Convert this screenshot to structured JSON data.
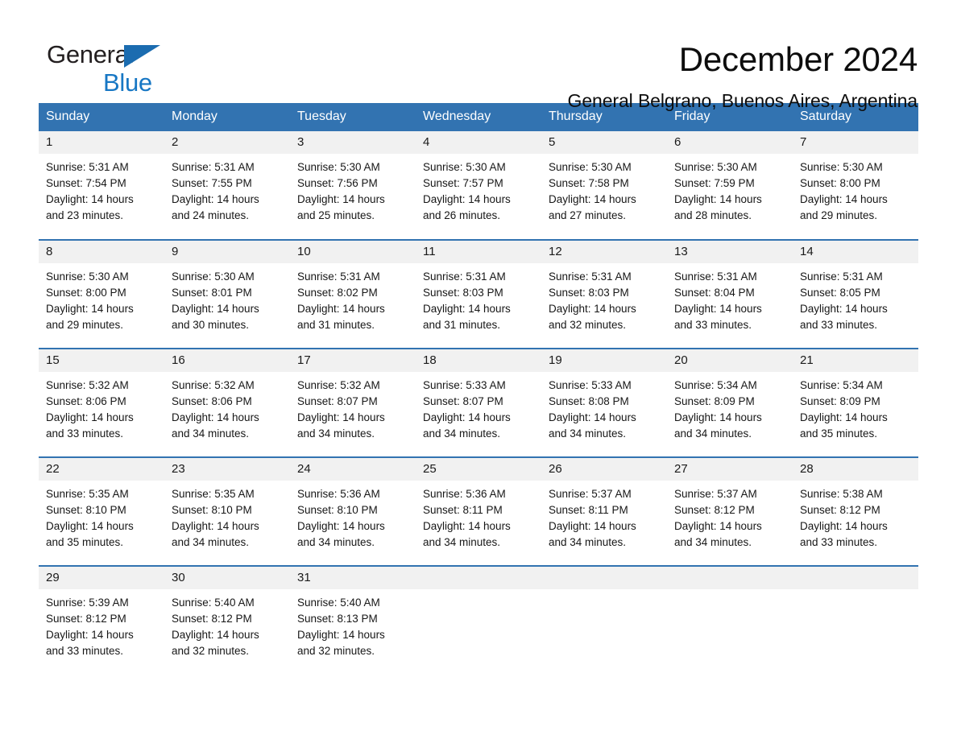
{
  "brand": {
    "line1": "General",
    "line2": "Blue",
    "accent_color": "#1777c4",
    "triangle_color": "#1b6cb0"
  },
  "header": {
    "title": "December 2024",
    "subtitle": "General Belgrano, Buenos Aires, Argentina"
  },
  "theme": {
    "header_row_bg": "#3273b1",
    "date_strip_bg": "#f1f1f1",
    "week_rule": "#3273b1"
  },
  "weekday_headers": [
    "Sunday",
    "Monday",
    "Tuesday",
    "Wednesday",
    "Thursday",
    "Friday",
    "Saturday"
  ],
  "weeks": [
    [
      {
        "date": "1",
        "sunrise": "Sunrise: 5:31 AM",
        "sunset": "Sunset: 7:54 PM",
        "daylight_line1": "Daylight: 14 hours",
        "daylight_line2": "and 23 minutes."
      },
      {
        "date": "2",
        "sunrise": "Sunrise: 5:31 AM",
        "sunset": "Sunset: 7:55 PM",
        "daylight_line1": "Daylight: 14 hours",
        "daylight_line2": "and 24 minutes."
      },
      {
        "date": "3",
        "sunrise": "Sunrise: 5:30 AM",
        "sunset": "Sunset: 7:56 PM",
        "daylight_line1": "Daylight: 14 hours",
        "daylight_line2": "and 25 minutes."
      },
      {
        "date": "4",
        "sunrise": "Sunrise: 5:30 AM",
        "sunset": "Sunset: 7:57 PM",
        "daylight_line1": "Daylight: 14 hours",
        "daylight_line2": "and 26 minutes."
      },
      {
        "date": "5",
        "sunrise": "Sunrise: 5:30 AM",
        "sunset": "Sunset: 7:58 PM",
        "daylight_line1": "Daylight: 14 hours",
        "daylight_line2": "and 27 minutes."
      },
      {
        "date": "6",
        "sunrise": "Sunrise: 5:30 AM",
        "sunset": "Sunset: 7:59 PM",
        "daylight_line1": "Daylight: 14 hours",
        "daylight_line2": "and 28 minutes."
      },
      {
        "date": "7",
        "sunrise": "Sunrise: 5:30 AM",
        "sunset": "Sunset: 8:00 PM",
        "daylight_line1": "Daylight: 14 hours",
        "daylight_line2": "and 29 minutes."
      }
    ],
    [
      {
        "date": "8",
        "sunrise": "Sunrise: 5:30 AM",
        "sunset": "Sunset: 8:00 PM",
        "daylight_line1": "Daylight: 14 hours",
        "daylight_line2": "and 29 minutes."
      },
      {
        "date": "9",
        "sunrise": "Sunrise: 5:30 AM",
        "sunset": "Sunset: 8:01 PM",
        "daylight_line1": "Daylight: 14 hours",
        "daylight_line2": "and 30 minutes."
      },
      {
        "date": "10",
        "sunrise": "Sunrise: 5:31 AM",
        "sunset": "Sunset: 8:02 PM",
        "daylight_line1": "Daylight: 14 hours",
        "daylight_line2": "and 31 minutes."
      },
      {
        "date": "11",
        "sunrise": "Sunrise: 5:31 AM",
        "sunset": "Sunset: 8:03 PM",
        "daylight_line1": "Daylight: 14 hours",
        "daylight_line2": "and 31 minutes."
      },
      {
        "date": "12",
        "sunrise": "Sunrise: 5:31 AM",
        "sunset": "Sunset: 8:03 PM",
        "daylight_line1": "Daylight: 14 hours",
        "daylight_line2": "and 32 minutes."
      },
      {
        "date": "13",
        "sunrise": "Sunrise: 5:31 AM",
        "sunset": "Sunset: 8:04 PM",
        "daylight_line1": "Daylight: 14 hours",
        "daylight_line2": "and 33 minutes."
      },
      {
        "date": "14",
        "sunrise": "Sunrise: 5:31 AM",
        "sunset": "Sunset: 8:05 PM",
        "daylight_line1": "Daylight: 14 hours",
        "daylight_line2": "and 33 minutes."
      }
    ],
    [
      {
        "date": "15",
        "sunrise": "Sunrise: 5:32 AM",
        "sunset": "Sunset: 8:06 PM",
        "daylight_line1": "Daylight: 14 hours",
        "daylight_line2": "and 33 minutes."
      },
      {
        "date": "16",
        "sunrise": "Sunrise: 5:32 AM",
        "sunset": "Sunset: 8:06 PM",
        "daylight_line1": "Daylight: 14 hours",
        "daylight_line2": "and 34 minutes."
      },
      {
        "date": "17",
        "sunrise": "Sunrise: 5:32 AM",
        "sunset": "Sunset: 8:07 PM",
        "daylight_line1": "Daylight: 14 hours",
        "daylight_line2": "and 34 minutes."
      },
      {
        "date": "18",
        "sunrise": "Sunrise: 5:33 AM",
        "sunset": "Sunset: 8:07 PM",
        "daylight_line1": "Daylight: 14 hours",
        "daylight_line2": "and 34 minutes."
      },
      {
        "date": "19",
        "sunrise": "Sunrise: 5:33 AM",
        "sunset": "Sunset: 8:08 PM",
        "daylight_line1": "Daylight: 14 hours",
        "daylight_line2": "and 34 minutes."
      },
      {
        "date": "20",
        "sunrise": "Sunrise: 5:34 AM",
        "sunset": "Sunset: 8:09 PM",
        "daylight_line1": "Daylight: 14 hours",
        "daylight_line2": "and 34 minutes."
      },
      {
        "date": "21",
        "sunrise": "Sunrise: 5:34 AM",
        "sunset": "Sunset: 8:09 PM",
        "daylight_line1": "Daylight: 14 hours",
        "daylight_line2": "and 35 minutes."
      }
    ],
    [
      {
        "date": "22",
        "sunrise": "Sunrise: 5:35 AM",
        "sunset": "Sunset: 8:10 PM",
        "daylight_line1": "Daylight: 14 hours",
        "daylight_line2": "and 35 minutes."
      },
      {
        "date": "23",
        "sunrise": "Sunrise: 5:35 AM",
        "sunset": "Sunset: 8:10 PM",
        "daylight_line1": "Daylight: 14 hours",
        "daylight_line2": "and 34 minutes."
      },
      {
        "date": "24",
        "sunrise": "Sunrise: 5:36 AM",
        "sunset": "Sunset: 8:10 PM",
        "daylight_line1": "Daylight: 14 hours",
        "daylight_line2": "and 34 minutes."
      },
      {
        "date": "25",
        "sunrise": "Sunrise: 5:36 AM",
        "sunset": "Sunset: 8:11 PM",
        "daylight_line1": "Daylight: 14 hours",
        "daylight_line2": "and 34 minutes."
      },
      {
        "date": "26",
        "sunrise": "Sunrise: 5:37 AM",
        "sunset": "Sunset: 8:11 PM",
        "daylight_line1": "Daylight: 14 hours",
        "daylight_line2": "and 34 minutes."
      },
      {
        "date": "27",
        "sunrise": "Sunrise: 5:37 AM",
        "sunset": "Sunset: 8:12 PM",
        "daylight_line1": "Daylight: 14 hours",
        "daylight_line2": "and 34 minutes."
      },
      {
        "date": "28",
        "sunrise": "Sunrise: 5:38 AM",
        "sunset": "Sunset: 8:12 PM",
        "daylight_line1": "Daylight: 14 hours",
        "daylight_line2": "and 33 minutes."
      }
    ],
    [
      {
        "date": "29",
        "sunrise": "Sunrise: 5:39 AM",
        "sunset": "Sunset: 8:12 PM",
        "daylight_line1": "Daylight: 14 hours",
        "daylight_line2": "and 33 minutes."
      },
      {
        "date": "30",
        "sunrise": "Sunrise: 5:40 AM",
        "sunset": "Sunset: 8:12 PM",
        "daylight_line1": "Daylight: 14 hours",
        "daylight_line2": "and 32 minutes."
      },
      {
        "date": "31",
        "sunrise": "Sunrise: 5:40 AM",
        "sunset": "Sunset: 8:13 PM",
        "daylight_line1": "Daylight: 14 hours",
        "daylight_line2": "and 32 minutes."
      },
      {
        "date": "",
        "sunrise": "",
        "sunset": "",
        "daylight_line1": "",
        "daylight_line2": ""
      },
      {
        "date": "",
        "sunrise": "",
        "sunset": "",
        "daylight_line1": "",
        "daylight_line2": ""
      },
      {
        "date": "",
        "sunrise": "",
        "sunset": "",
        "daylight_line1": "",
        "daylight_line2": ""
      },
      {
        "date": "",
        "sunrise": "",
        "sunset": "",
        "daylight_line1": "",
        "daylight_line2": ""
      }
    ]
  ]
}
